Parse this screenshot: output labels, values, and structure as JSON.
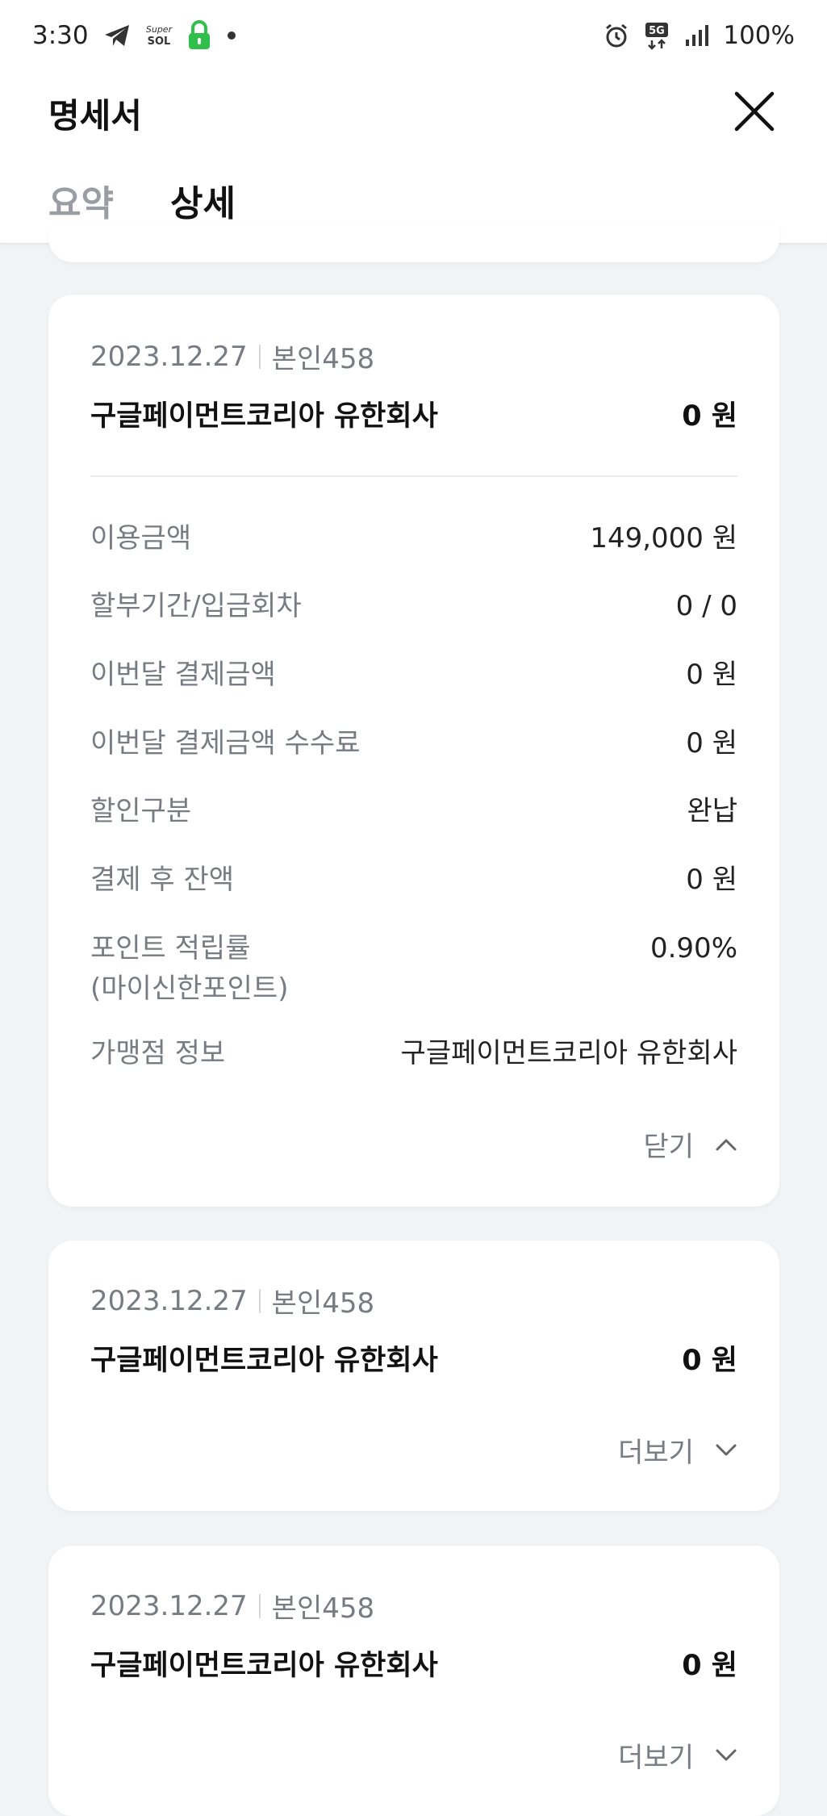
{
  "status_bar": {
    "time": "3:30",
    "left_icons": [
      "telegram-icon",
      "super-sol-icon",
      "lock-icon",
      "dot-icon"
    ],
    "super_sol_label": "Super SOL",
    "network_label": "5G",
    "battery": "100%"
  },
  "header": {
    "title": "명세서",
    "tabs": [
      {
        "label": "요약",
        "active": false
      },
      {
        "label": "상세",
        "active": true
      }
    ]
  },
  "transactions": [
    {
      "date": "2023.12.27",
      "card_holder": "본인458",
      "merchant": "구글페이먼트코리아 유한회사",
      "amount": "0 원",
      "expanded": true,
      "details": [
        {
          "label": "이용금액",
          "value": "149,000 원"
        },
        {
          "label": "할부기간/입금회차",
          "value": "0 / 0"
        },
        {
          "label": "이번달 결제금액",
          "value": "0 원"
        },
        {
          "label": "이번달 결제금액 수수료",
          "value": "0 원"
        },
        {
          "label": "할인구분",
          "value": "완납"
        },
        {
          "label": "결제 후 잔액",
          "value": "0 원"
        },
        {
          "label": "포인트 적립률",
          "label_line2": "(마이신한포인트)",
          "value": "0.90%"
        },
        {
          "label": "가맹점 정보",
          "value": "구글페이먼트코리아 유한회사"
        }
      ],
      "toggle_label": "닫기"
    },
    {
      "date": "2023.12.27",
      "card_holder": "본인458",
      "merchant": "구글페이먼트코리아 유한회사",
      "amount": "0 원",
      "expanded": false,
      "toggle_label": "더보기"
    },
    {
      "date": "2023.12.27",
      "card_holder": "본인458",
      "merchant": "구글페이먼트코리아 유한회사",
      "amount": "0 원",
      "expanded": false,
      "toggle_label": "더보기"
    }
  ]
}
